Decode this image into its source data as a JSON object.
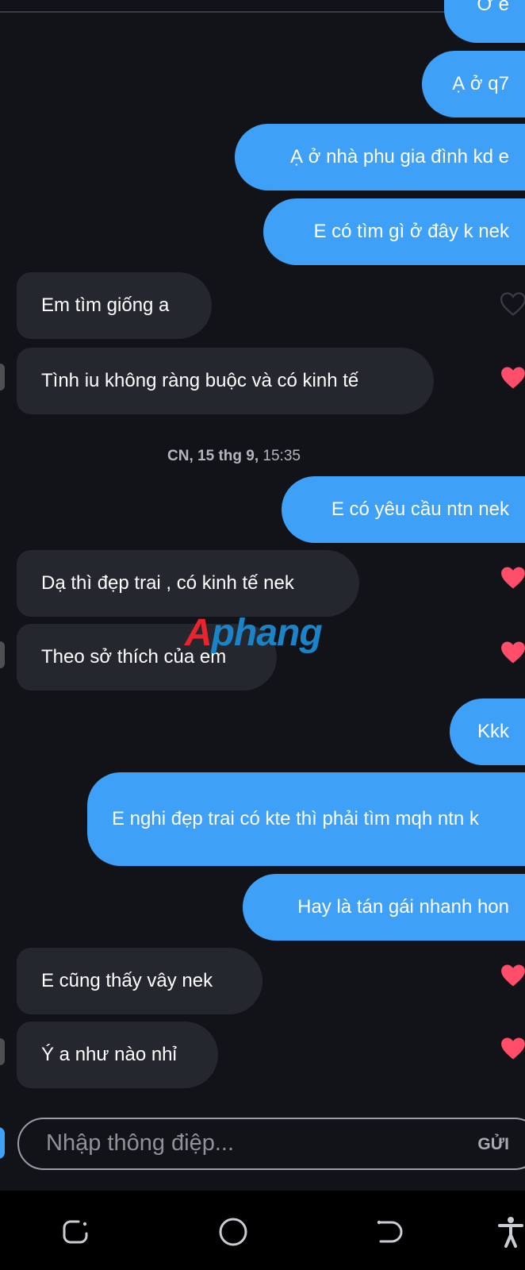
{
  "messages": [
    {
      "id": "m0",
      "dir": "out",
      "text": "Ơ e"
    },
    {
      "id": "m1",
      "dir": "out",
      "text": "Ạ ở q7"
    },
    {
      "id": "m2",
      "dir": "out",
      "text": "Ạ ở nhà phu gia đình kd e"
    },
    {
      "id": "m3",
      "dir": "out",
      "text": "E có tìm gì ở đây k nek"
    },
    {
      "id": "m4",
      "dir": "in",
      "text": "Em tìm giống a",
      "liked": false
    },
    {
      "id": "m5",
      "dir": "in",
      "text": "Tình iu không ràng buộc và có kinh tế",
      "liked": true
    },
    {
      "id": "m6",
      "dir": "out",
      "text": "E có yêu cầu ntn nek"
    },
    {
      "id": "m7",
      "dir": "in",
      "text": "Dạ thì đẹp trai , có kinh tế nek",
      "liked": true
    },
    {
      "id": "m8",
      "dir": "in",
      "text": "Theo sở thích của em",
      "liked": true
    },
    {
      "id": "m9",
      "dir": "out",
      "text": "Kkk"
    },
    {
      "id": "m10",
      "dir": "out",
      "text": "E nghi đẹp trai có kte thì phải tìm mqh ntn k"
    },
    {
      "id": "m11",
      "dir": "out",
      "text": "Hay là tán gái nhanh hon"
    },
    {
      "id": "m12",
      "dir": "in",
      "text": "E cũng thấy vây nek",
      "liked": true
    },
    {
      "id": "m13",
      "dir": "in",
      "text": "Ý a như nào nhỉ",
      "liked": true
    }
  ],
  "timestamp": {
    "day": "CN, 15 thg 9,",
    "time": "15:35"
  },
  "watermark": {
    "part1": "A",
    "part2": "phang"
  },
  "composer": {
    "placeholder": "Nhập thông điệp...",
    "send_label": "GỬI"
  },
  "colors": {
    "accent": "#3ea0f7",
    "heart": "#ff4d6a",
    "background": "#111318",
    "incoming": "#24272e"
  },
  "icons": {
    "like": "heart-icon",
    "nav": [
      "recent-apps-icon",
      "home-icon",
      "back-icon",
      "accessibility-icon"
    ]
  }
}
